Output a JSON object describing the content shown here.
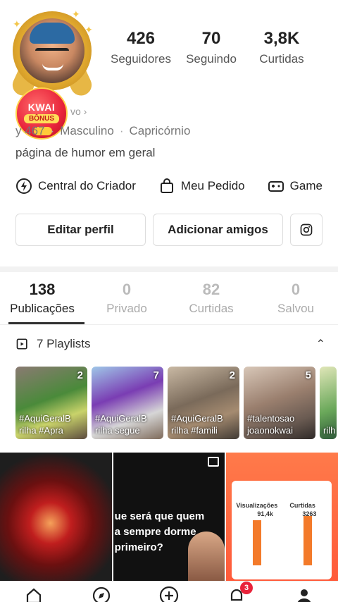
{
  "profile": {
    "stats": [
      {
        "value": "426",
        "label": "Seguidores"
      },
      {
        "value": "70",
        "label": "Seguindo"
      },
      {
        "value": "3,8K",
        "label": "Curtidas"
      }
    ],
    "badge": {
      "line1": "KWAI",
      "line2": "BÔNUS"
    },
    "id_fragment": "vo",
    "id_number": "y 467",
    "gender": "Masculino",
    "sign": "Capricórnio",
    "bio": "página de humor em geral"
  },
  "shortcuts": [
    {
      "label": "Central do Criador",
      "icon": "lightning-icon"
    },
    {
      "label": "Meu Pedido",
      "icon": "shopping-bag-icon"
    },
    {
      "label": "Game",
      "icon": "gamepad-icon"
    }
  ],
  "actions": {
    "edit_label": "Editar perfil",
    "add_label": "Adicionar amigos",
    "instagram_icon": "instagram-icon"
  },
  "tabs": [
    {
      "count": "138",
      "label": "Publicações",
      "active": true
    },
    {
      "count": "0",
      "label": "Privado",
      "active": false
    },
    {
      "count": "82",
      "label": "Curtidas",
      "active": false
    },
    {
      "count": "0",
      "label": "Salvou",
      "active": false
    }
  ],
  "playlists": {
    "title": "7 Playlists",
    "items": [
      {
        "count": "2",
        "caption": "#AquiGeralB rilha #Apra"
      },
      {
        "count": "7",
        "caption": "#AquiGeralB rilha segue"
      },
      {
        "count": "2",
        "caption": "#AquiGeralB rilha #famili"
      },
      {
        "count": "5",
        "caption": "#talentosao joaonokwai"
      },
      {
        "count": "",
        "caption": "rilh"
      }
    ]
  },
  "grid": {
    "post2_text": "ue será que quem\na sempre dorme\nprimeiro?",
    "post3": {
      "views_label": "Visualizações",
      "views_value": "91,4k",
      "likes_label": "Curtidas",
      "likes_value": "3263"
    }
  },
  "nav": {
    "notification_count": "3",
    "items": [
      "home-icon",
      "discover-icon",
      "create-icon",
      "notifications-icon",
      "profile-icon"
    ]
  }
}
